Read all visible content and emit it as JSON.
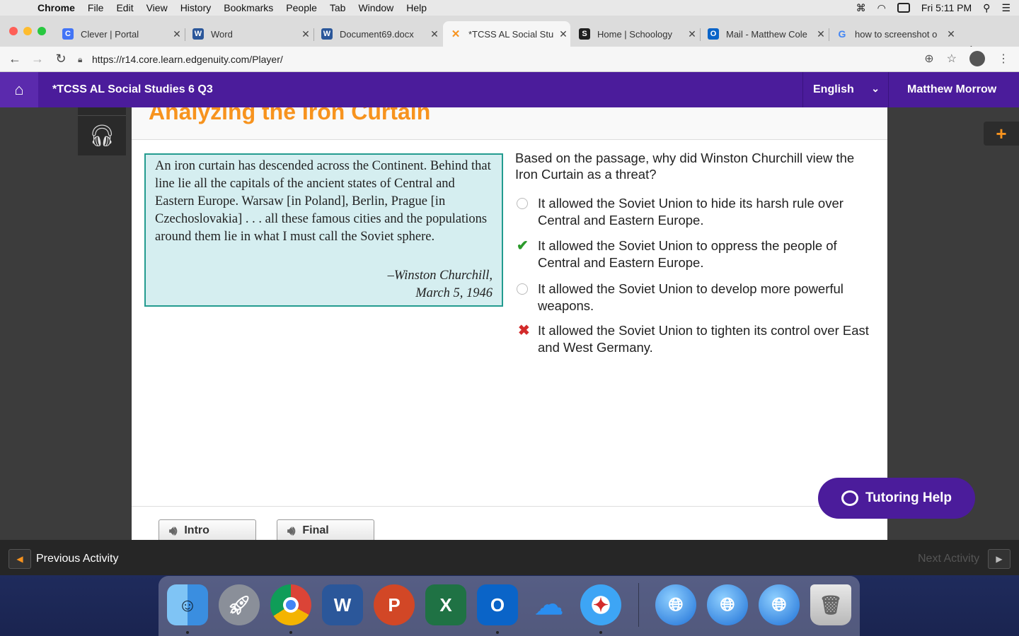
{
  "menubar": {
    "app_name": "Chrome",
    "items": [
      "File",
      "Edit",
      "View",
      "History",
      "Bookmarks",
      "People",
      "Tab",
      "Window",
      "Help"
    ],
    "clock": "Fri 5:11 PM"
  },
  "tabs": [
    {
      "title": "Clever | Portal",
      "icon": "clever-icon",
      "color": "#4274f6",
      "glyph": "C"
    },
    {
      "title": "Word",
      "icon": "word-icon",
      "color": "#2b579a",
      "glyph": "W"
    },
    {
      "title": "Document69.docx",
      "icon": "word-icon",
      "color": "#2b579a",
      "glyph": "W"
    },
    {
      "title": "*TCSS AL Social Stu",
      "icon": "edgenuity-icon",
      "color": "#f7931e",
      "glyph": "✕"
    },
    {
      "title": "Home | Schoology",
      "icon": "schoology-icon",
      "color": "#1f1f1f",
      "glyph": "S"
    },
    {
      "title": "Mail - Matthew Cole",
      "icon": "outlook-icon",
      "color": "#0a64c8",
      "glyph": "O"
    },
    {
      "title": "how to screenshot o",
      "icon": "google-icon",
      "color": "#4285f4",
      "glyph": "G"
    }
  ],
  "address": {
    "url": "https://r14.core.learn.edgenuity.com/Player/"
  },
  "header": {
    "course_title": "*TCSS AL Social Studies 6 Q3",
    "language": "English",
    "user_name": "Matthew Morrow"
  },
  "activity": {
    "title": "Analyzing the Iron Curtain"
  },
  "passage": {
    "text": "An iron curtain has descended across the Continent. Behind that line lie all the capitals of the ancient states of Central and Eastern Europe. Warsaw [in Poland], Berlin, Prague [in Czechoslovakia] . . . all these famous cities and the populations around them lie in what I must call the Soviet sphere.",
    "attribution_1": "–Winston Churchill,",
    "attribution_2": "March 5, 1946"
  },
  "question": {
    "prompt": "Based on the passage, why did Winston Churchill view the Iron Curtain as a threat?",
    "options": [
      {
        "text": "It allowed the Soviet Union to hide its harsh rule over Central and Eastern Europe.",
        "state": "unselected"
      },
      {
        "text": "It allowed the Soviet Union to oppress the people of Central and Eastern Europe.",
        "state": "correct"
      },
      {
        "text": "It allowed the Soviet Union to develop more powerful weapons.",
        "state": "unselected"
      },
      {
        "text": "It allowed the Soviet Union to tighten its control over East and West Germany.",
        "state": "incorrect"
      }
    ]
  },
  "audio": {
    "intro_label": "Intro",
    "final_label": "Final"
  },
  "tutoring": {
    "label": "Tutoring Help"
  },
  "activity_nav": {
    "previous_label": "Previous Activity",
    "next_label": "Next Activity"
  },
  "colors": {
    "brand_purple": "#4b1c9b",
    "accent_orange": "#f7931e",
    "correct_green": "#2b9a2b",
    "incorrect_red": "#d32b2b",
    "passage_bg": "#d5eef0",
    "passage_border": "#239b8f"
  },
  "dock": [
    "finder-icon",
    "launchpad-icon",
    "chrome-icon",
    "word-icon",
    "powerpoint-icon",
    "excel-icon",
    "outlook-icon",
    "onedrive-icon",
    "safari-icon",
    "globe-icon",
    "globe-icon",
    "globe-icon",
    "trash-icon"
  ]
}
